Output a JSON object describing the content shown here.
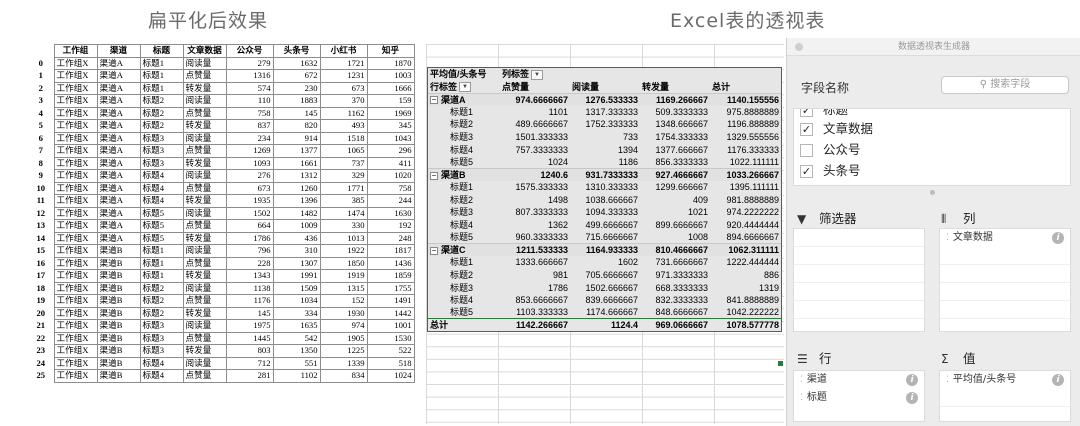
{
  "headings": {
    "left": "扁平化后效果",
    "right": "Excel表的透视表"
  },
  "flat_table": {
    "columns": [
      "工作组",
      "渠道",
      "标题",
      "文章数据",
      "公众号",
      "头条号",
      "小红书",
      "知乎"
    ],
    "rows": [
      [
        "0",
        "工作组X",
        "渠道A",
        "标题1",
        "阅读量",
        "279",
        "1632",
        "1721",
        "1870"
      ],
      [
        "1",
        "工作组X",
        "渠道A",
        "标题1",
        "点赞量",
        "1316",
        "672",
        "1231",
        "1003"
      ],
      [
        "2",
        "工作组X",
        "渠道A",
        "标题1",
        "转发量",
        "574",
        "230",
        "673",
        "1666"
      ],
      [
        "3",
        "工作组X",
        "渠道A",
        "标题2",
        "阅读量",
        "110",
        "1883",
        "370",
        "159"
      ],
      [
        "4",
        "工作组X",
        "渠道A",
        "标题2",
        "点赞量",
        "758",
        "145",
        "1162",
        "1969"
      ],
      [
        "5",
        "工作组X",
        "渠道A",
        "标题2",
        "转发量",
        "837",
        "820",
        "493",
        "345"
      ],
      [
        "6",
        "工作组X",
        "渠道A",
        "标题3",
        "阅读量",
        "234",
        "914",
        "1518",
        "1043"
      ],
      [
        "7",
        "工作组X",
        "渠道A",
        "标题3",
        "点赞量",
        "1269",
        "1377",
        "1065",
        "296"
      ],
      [
        "8",
        "工作组X",
        "渠道A",
        "标题3",
        "转发量",
        "1093",
        "1661",
        "737",
        "411"
      ],
      [
        "9",
        "工作组X",
        "渠道A",
        "标题4",
        "阅读量",
        "276",
        "1312",
        "329",
        "1020"
      ],
      [
        "10",
        "工作组X",
        "渠道A",
        "标题4",
        "点赞量",
        "673",
        "1260",
        "1771",
        "758"
      ],
      [
        "11",
        "工作组X",
        "渠道A",
        "标题4",
        "转发量",
        "1935",
        "1396",
        "385",
        "244"
      ],
      [
        "12",
        "工作组X",
        "渠道A",
        "标题5",
        "阅读量",
        "1502",
        "1482",
        "1474",
        "1630"
      ],
      [
        "13",
        "工作组X",
        "渠道A",
        "标题5",
        "点赞量",
        "664",
        "1009",
        "330",
        "192"
      ],
      [
        "14",
        "工作组X",
        "渠道A",
        "标题5",
        "转发量",
        "1786",
        "436",
        "1013",
        "248"
      ],
      [
        "15",
        "工作组X",
        "渠道B",
        "标题1",
        "阅读量",
        "796",
        "310",
        "1922",
        "1817"
      ],
      [
        "16",
        "工作组X",
        "渠道B",
        "标题1",
        "点赞量",
        "228",
        "1307",
        "1850",
        "1436"
      ],
      [
        "17",
        "工作组X",
        "渠道B",
        "标题1",
        "转发量",
        "1343",
        "1991",
        "1919",
        "1859"
      ],
      [
        "18",
        "工作组X",
        "渠道B",
        "标题2",
        "阅读量",
        "1138",
        "1509",
        "1315",
        "1755"
      ],
      [
        "19",
        "工作组X",
        "渠道B",
        "标题2",
        "点赞量",
        "1176",
        "1034",
        "152",
        "1491"
      ],
      [
        "20",
        "工作组X",
        "渠道B",
        "标题2",
        "转发量",
        "145",
        "334",
        "1930",
        "1442"
      ],
      [
        "21",
        "工作组X",
        "渠道B",
        "标题3",
        "阅读量",
        "1975",
        "1635",
        "974",
        "1001"
      ],
      [
        "22",
        "工作组X",
        "渠道B",
        "标题3",
        "点赞量",
        "1445",
        "542",
        "1905",
        "1530"
      ],
      [
        "23",
        "工作组X",
        "渠道B",
        "标题3",
        "转发量",
        "803",
        "1350",
        "1225",
        "522"
      ],
      [
        "24",
        "工作组X",
        "渠道B",
        "标题4",
        "阅读量",
        "712",
        "551",
        "1339",
        "518"
      ],
      [
        "25",
        "工作组X",
        "渠道B",
        "标题4",
        "点赞量",
        "281",
        "1102",
        "834",
        "1024"
      ]
    ]
  },
  "pivot": {
    "header_row1": [
      "平均值/头条号",
      "列标签",
      "",
      "",
      ""
    ],
    "header_row2": [
      "行标签",
      "点赞量",
      "阅读量",
      "转发量",
      "总计"
    ],
    "rows": [
      {
        "kind": "grp",
        "cells": [
          "渠道A",
          "974.6666667",
          "1276.533333",
          "1169.266667",
          "1140.155556"
        ]
      },
      {
        "kind": "sub",
        "cells": [
          "标题1",
          "",
          "1101",
          "1317.333333",
          "509.3333333",
          "975.8888889"
        ]
      },
      {
        "kind": "sub",
        "cells": [
          "标题2",
          "489.6666667",
          "1752.333333",
          "1348.666667",
          "1196.888889"
        ]
      },
      {
        "kind": "sub",
        "cells": [
          "标题3",
          "1501.333333",
          "733",
          "1754.333333",
          "1329.555556"
        ]
      },
      {
        "kind": "sub",
        "cells": [
          "标题4",
          "757.3333333",
          "1394",
          "1377.666667",
          "1176.333333"
        ]
      },
      {
        "kind": "sub",
        "cells": [
          "标题5",
          "1024",
          "1186",
          "856.3333333",
          "1022.111111"
        ]
      },
      {
        "kind": "grp",
        "cells": [
          "渠道B",
          "1240.6",
          "931.7333333",
          "927.4666667",
          "1033.266667"
        ]
      },
      {
        "kind": "sub",
        "cells": [
          "标题1",
          "1575.333333",
          "1310.333333",
          "1299.666667",
          "1395.111111"
        ]
      },
      {
        "kind": "sub",
        "cells": [
          "标题2",
          "1498",
          "1038.666667",
          "409",
          "981.8888889"
        ]
      },
      {
        "kind": "sub",
        "cells": [
          "标题3",
          "807.3333333",
          "1094.333333",
          "1021",
          "974.2222222"
        ]
      },
      {
        "kind": "sub",
        "cells": [
          "标题4",
          "1362",
          "499.6666667",
          "899.6666667",
          "920.4444444"
        ]
      },
      {
        "kind": "sub",
        "cells": [
          "标题5",
          "960.3333333",
          "715.6666667",
          "1008",
          "894.6666667"
        ]
      },
      {
        "kind": "grp",
        "cells": [
          "渠道C",
          "1211.533333",
          "1164.933333",
          "810.4666667",
          "1062.311111"
        ]
      },
      {
        "kind": "sub",
        "cells": [
          "标题1",
          "1333.666667",
          "1602",
          "731.6666667",
          "1222.444444"
        ]
      },
      {
        "kind": "sub",
        "cells": [
          "标题2",
          "981",
          "705.6666667",
          "971.3333333",
          "886"
        ]
      },
      {
        "kind": "sub",
        "cells": [
          "标题3",
          "1786",
          "1502.666667",
          "668.3333333",
          "1319"
        ]
      },
      {
        "kind": "sub",
        "cells": [
          "标题4",
          "853.6666667",
          "839.6666667",
          "832.3333333",
          "841.8888889"
        ]
      },
      {
        "kind": "sub",
        "cells": [
          "标题5",
          "1103.333333",
          "1174.666667",
          "848.6666667",
          "1042.222222"
        ]
      },
      {
        "kind": "total",
        "cells": [
          "总计",
          "1142.266667",
          "1124.4",
          "969.0666667",
          "1078.577778"
        ]
      }
    ]
  },
  "builder": {
    "title": "数据透视表生成器",
    "field_name_label": "字段名称",
    "search_placeholder": "搜索字段",
    "fields": [
      {
        "label": "标题",
        "checked": true
      },
      {
        "label": "文章数据",
        "checked": true
      },
      {
        "label": "公众号",
        "checked": false
      },
      {
        "label": "头条号",
        "checked": true
      }
    ],
    "filters_label": "筛选器",
    "columns_label": "列",
    "rows_label": "行",
    "values_label": "值",
    "columns_items": [
      "文章数据"
    ],
    "rows_items": [
      "渠道",
      "标题"
    ],
    "values_items": [
      "平均值/头条号"
    ]
  },
  "colors": {
    "pivot_border": "#2b7a3d",
    "pivot_bg": "#e6e6e6",
    "panel_bg": "#ececec"
  }
}
